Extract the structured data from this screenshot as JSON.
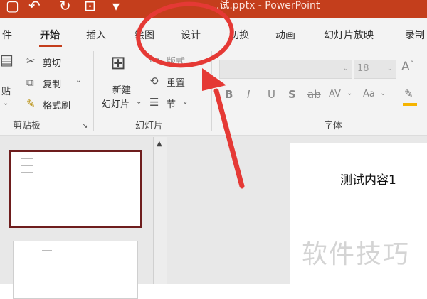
{
  "titlebar": {
    "filename": "...试.pptx  -  PowerPoint",
    "icons": [
      "save-icon",
      "undo-icon",
      "redo-icon",
      "presenter-icon",
      "customize-icon"
    ]
  },
  "tabs": [
    "件",
    "开始",
    "插入",
    "绘图",
    "设计",
    "切换",
    "动画",
    "幻灯片放映",
    "录制"
  ],
  "active_tab": "开始",
  "clipboard": {
    "paste": "贴",
    "cut": "剪切",
    "copy": "复制",
    "format_painter": "格式刷",
    "group_label": "剪贴板"
  },
  "slides_group": {
    "new_slide_line1": "新建",
    "new_slide_line2": "幻灯片",
    "layout": "版式",
    "reset": "重置",
    "section": "节",
    "group_label": "幻灯片"
  },
  "font_group": {
    "font_size": "18",
    "bold": "B",
    "italic": "I",
    "underline": "U",
    "shadow": "S",
    "strikethrough": "ab",
    "spacing": "AV",
    "case": "Aa",
    "group_label": "字体"
  },
  "slide": {
    "title": "测试内容1"
  },
  "watermark": "软件技巧",
  "colors": {
    "titlebar": "#c43e1c",
    "ribbon": "#f3f3f3",
    "annotation": "#e53935",
    "selected_thumb": "#6e1d1d"
  }
}
